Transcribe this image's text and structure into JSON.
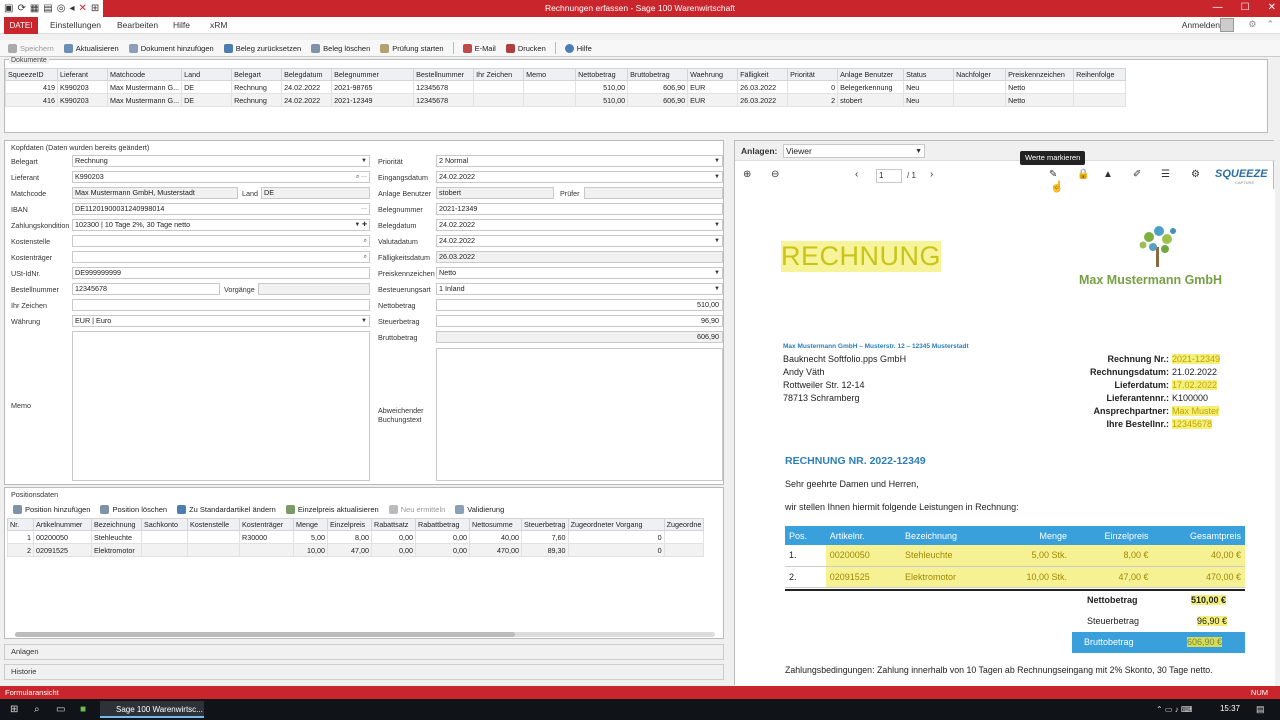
{
  "window": {
    "title": "Rechnungen erfassen  -  Sage 100 Warenwirtschaft"
  },
  "menu": {
    "datei": "DATEI",
    "items": [
      "Einstellungen",
      "Bearbeiten",
      "Hilfe",
      "xRM"
    ],
    "login": "Anmelden"
  },
  "toolbar": [
    "Speichern",
    "Aktualisieren",
    "Dokument hinzufügen",
    "Beleg zurücksetzen",
    "Beleg löschen",
    "Prüfung starten",
    "E-Mail",
    "Drucken",
    "Hilfe"
  ],
  "docs": {
    "label": "Dokumente",
    "columns": [
      "SqueezeID",
      "Lieferant",
      "Matchcode",
      "Land",
      "Belegart",
      "Belegdatum",
      "Belegnummer",
      "Bestellnummer",
      "Ihr Zeichen",
      "Memo",
      "Nettobetrag",
      "Bruttobetrag",
      "Waehrung",
      "Fälligkeit",
      "Priorität",
      "Anlage Benutzer",
      "Status",
      "Nachfolger",
      "Preiskennzeichen",
      "Reihenfolge"
    ],
    "rows": [
      [
        "419",
        "K990203",
        "Max Mustermann G...",
        "DE",
        "Rechnung",
        "24.02.2022",
        "2021-98765",
        "12345678",
        "",
        "",
        "510,00",
        "606,90",
        "EUR",
        "26.03.2022",
        "0",
        "Belegerkennung",
        "Neu",
        "",
        "Netto",
        ""
      ],
      [
        "416",
        "K990203",
        "Max Mustermann G...",
        "DE",
        "Rechnung",
        "24.02.2022",
        "2021-12349",
        "12345678",
        "",
        "",
        "510,00",
        "606,90",
        "EUR",
        "26.03.2022",
        "2",
        "stobert",
        "Neu",
        "",
        "Netto",
        ""
      ]
    ]
  },
  "kopf": {
    "header": "Kopfdaten (Daten wurden bereits geändert)",
    "belegart_l": "Belegart",
    "belegart": "Rechnung",
    "lieferant_l": "Lieferant",
    "lieferant": "K990203",
    "matchcode_l": "Matchcode",
    "matchcode": "Max Mustermann GmbH, Musterstadt",
    "land_l": "Land",
    "land": "DE",
    "iban_l": "IBAN",
    "iban": "DE11201900031240998014",
    "zahlung_l": "Zahlungskondition",
    "zahlung": "102300 | 10 Tage 2%, 30 Tage netto",
    "kostenstelle_l": "Kostenstelle",
    "kostentraeger_l": "Kostenträger",
    "ust_l": "USt-IdNr.",
    "ust": "DE999999999",
    "bestell_l": "Bestellnummer",
    "bestell": "12345678",
    "vorgaenge_l": "Vorgänge",
    "zeichen_l": "Ihr Zeichen",
    "waehrung_l": "Währung",
    "waehrung": "EUR | Euro",
    "memo_l": "Memo",
    "prio_l": "Priorität",
    "prio": "2   Normal",
    "eingang_l": "Eingangsdatum",
    "eingang": "24.02.2022",
    "anlbenutzer_l": "Anlage Benutzer",
    "anlbenutzer": "stobert",
    "pruefer_l": "Prüfer",
    "belegnr_l": "Belegnummer",
    "belegnr": "2021-12349",
    "belegdatum_l": "Belegdatum",
    "belegdatum": "24.02.2022",
    "valuta_l": "Valutadatum",
    "valuta": "24.02.2022",
    "faellig_l": "Fälligkeitsdatum",
    "faellig": "26.03.2022",
    "preisk_l": "Preiskennzeichen",
    "preisk": "Netto",
    "besteuer_l": "Besteuerungsart",
    "besteuer": "1   Inland",
    "netto_l": "Nettobetrag",
    "netto": "510,00",
    "steuer_l": "Steuerbetrag",
    "steuer": "96,90",
    "brutto_l": "Bruttobetrag",
    "brutto": "606,90",
    "abw_l1": "Abweichender",
    "abw_l2": "Buchungstext"
  },
  "pos": {
    "header": "Positionsdaten",
    "toolbar": [
      "Position hinzufügen",
      "Position löschen",
      "Zu Standardartikel ändern",
      "Einzelpreis aktualisieren",
      "Neu ermitteln",
      "Validierung"
    ],
    "columns": [
      "Nr.",
      "Artikelnummer",
      "Bezeichnung",
      "Sachkonto",
      "Kostenstelle",
      "Kostenträger",
      "Menge",
      "Einzelpreis",
      "Rabattsatz",
      "Rabattbetrag",
      "Nettosumme",
      "Steuerbetrag",
      "Zugeordneter Vorgang",
      "Zugeordne"
    ],
    "rows": [
      [
        "1",
        "00200050",
        "Stehleuchte",
        "",
        "",
        "R30000",
        "5,00",
        "8,00",
        "0,00",
        "0,00",
        "40,00",
        "7,60",
        "0",
        ""
      ],
      [
        "2",
        "02091525",
        "Elektromotor",
        "",
        "",
        "",
        "10,00",
        "47,00",
        "0,00",
        "0,00",
        "470,00",
        "89,30",
        "0",
        ""
      ]
    ]
  },
  "anlagen_label": "Anlagen",
  "historie_label": "Historie",
  "viewer": {
    "label": "Anlagen:",
    "mode": "Viewer",
    "page": "1",
    "total": "/ 1",
    "tooltip": "Werte markieren",
    "logo": "SQUEEZE",
    "logo_sub": "CAPTURE"
  },
  "invoice": {
    "title": "RECHNUNG",
    "company": "Max Mustermann GmbH",
    "sender": "Max Mustermann GmbH – Musterstr. 12 – 12345 Musterstadt",
    "addr": [
      "Bauknecht Softfolio.pps GmbH",
      "Andy Väth",
      "Rottweiler Str. 12-14",
      "78713 Schramberg"
    ],
    "meta": [
      {
        "k": "Rechnung Nr.:",
        "v": "2021-12349",
        "hl": true
      },
      {
        "k": "Rechnungsdatum:",
        "v": "21.02.2022",
        "hl": false
      },
      {
        "k": "Lieferdatum:",
        "v": "17.02.2022",
        "hl": true
      },
      {
        "k": "Lieferantennr.:",
        "v": "K100000",
        "hl": false
      },
      {
        "k": "Ansprechpartner:",
        "v": "Max Muster",
        "hl": true
      },
      {
        "k": "Ihre Bestellnr.:",
        "v": "12345678",
        "hl": true
      }
    ],
    "heading": "RECHNUNG NR. 2022-12349",
    "greet": "Sehr geehrte Damen und Herren,",
    "intro": "wir stellen Ihnen hiermit folgende Leistungen in Rechnung:",
    "cols": [
      "Pos.",
      "Artikelnr.",
      "Bezeichnung",
      "Menge",
      "Einzelpreis",
      "Gesamtpreis"
    ],
    "items": [
      [
        "1.",
        "00200050",
        "Stehleuchte",
        "5,00 Stk.",
        "8,00 €",
        "40,00 €"
      ],
      [
        "2.",
        "02091525",
        "Elektromotor",
        "10,00 Stk.",
        "47,00 €",
        "470,00 €"
      ]
    ],
    "netto_l": "Nettobetrag",
    "netto": "510,00 €",
    "steuer_l": "Steuerbetrag",
    "steuer": "96,90 €",
    "brutto_l": "Bruttobetrag",
    "brutto": "606,90 €",
    "terms": "Zahlungsbedingungen: Zahlung innerhalb von 10 Tagen ab Rechnungseingang mit 2% Skonto, 30 Tage netto."
  },
  "status": {
    "left": "Formularansicht",
    "right": "NUM"
  },
  "taskbar": {
    "app": "Sage 100 Warenwirtsc...",
    "time": "15:37"
  }
}
